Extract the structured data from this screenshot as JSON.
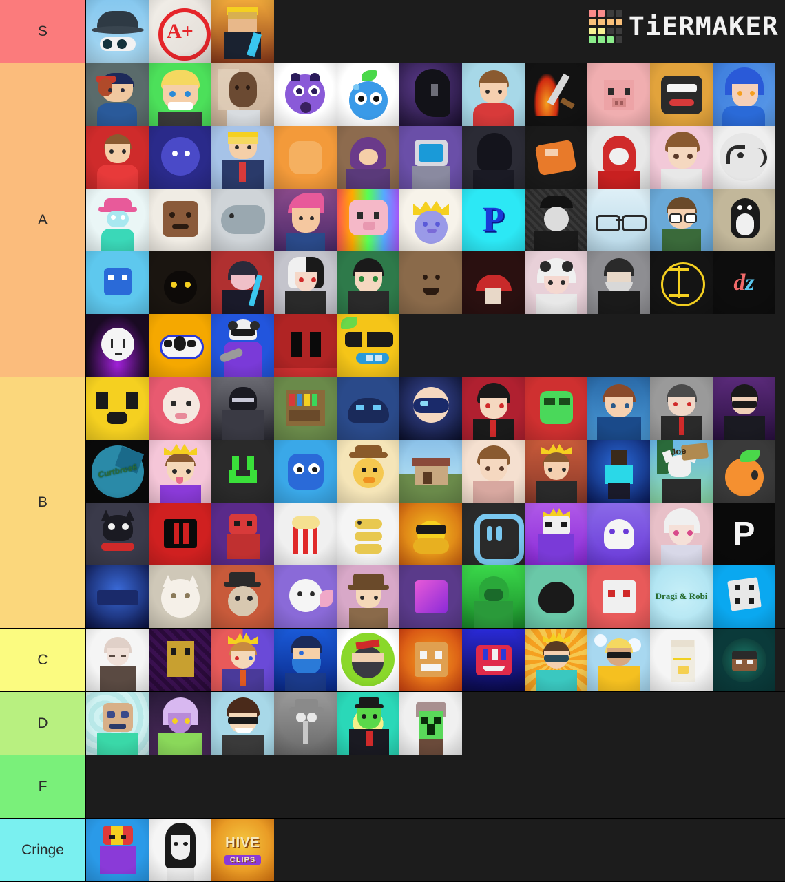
{
  "app": {
    "name": "TierMaker",
    "logo_word": "TiERMAKER",
    "logo_colors": [
      [
        "#f98b8b",
        "#f98b8b",
        "#3d3d3d",
        "#3d3d3d"
      ],
      [
        "#f9c07a",
        "#f9c07a",
        "#f9c07a",
        "#f9c07a"
      ],
      [
        "#f7f293",
        "#f7f293",
        "#3d3d3d",
        "#3d3d3d"
      ],
      [
        "#8ced8c",
        "#8ced8c",
        "#8ced8c",
        "#3d3d3d"
      ]
    ],
    "background": "#1c1c1c"
  },
  "tiers": [
    {
      "label": "S",
      "color": "#fb7b7c",
      "rows": 1,
      "items": [
        {
          "name": "bucket-hat-sunglasses",
          "caption": "",
          "bg": "#7ec3ee",
          "kind": "hat-shades"
        },
        {
          "name": "a-plus-grade",
          "caption": "A+",
          "bg": "#ede8e4",
          "kind": "aplus"
        },
        {
          "name": "minecraft-king-sword",
          "caption": "",
          "bg": "#c96a2a",
          "kind": "mc-king-sunset"
        }
      ]
    },
    {
      "label": "A",
      "color": "#fbbc7c",
      "rows": 5,
      "items": [
        {
          "name": "boy-red-cap-hoodie",
          "caption": "",
          "bg": "#5a6b6b",
          "kind": "cap-boy"
        },
        {
          "name": "blond-anime-grin",
          "caption": "",
          "bg": "#4ce05a",
          "kind": "blond-grin"
        },
        {
          "name": "photo-person-selfie",
          "caption": "",
          "bg": "#d8c6b4",
          "kind": "photo-face"
        },
        {
          "name": "purple-shocked-ball",
          "caption": "",
          "bg": "#ffffff",
          "kind": "shock-ball"
        },
        {
          "name": "blueberry-character",
          "caption": "",
          "bg": "#ffffff",
          "kind": "blueberry"
        },
        {
          "name": "black-hair-galaxy",
          "caption": "",
          "bg": "#2a1d4a",
          "kind": "dark-hair"
        },
        {
          "name": "brown-hair-red-shirt",
          "caption": "",
          "bg": "#a7d8e8",
          "kind": "brown-red"
        },
        {
          "name": "flame-sword-pixel",
          "caption": "",
          "bg": "#111111",
          "kind": "flame-sword"
        },
        {
          "name": "minecraft-pig-face",
          "caption": "",
          "bg": "#f0aeb0",
          "kind": "mc-pig"
        },
        {
          "name": "geometry-dash-cube",
          "caption": "",
          "bg": "#e2a33c",
          "kind": "gd-cube"
        },
        {
          "name": "blue-hair-anime",
          "caption": "",
          "bg": "#3d7ddd",
          "kind": "blue-hair"
        },
        {
          "name": "red-hoodie-boy",
          "caption": "",
          "bg": "#cf2b2b",
          "kind": "red-hoodie"
        },
        {
          "name": "blue-blob-face",
          "caption": "",
          "bg": "#2a2a8a",
          "kind": "blue-blob"
        },
        {
          "name": "king-crown-suit",
          "caption": "",
          "bg": "#a6c3e8",
          "kind": "king-suit"
        },
        {
          "name": "orange-square-blob",
          "caption": "",
          "bg": "#f39a3a",
          "kind": "orange-blob"
        },
        {
          "name": "hooded-traveler",
          "caption": "",
          "bg": "#8d6b4e",
          "kind": "hooded"
        },
        {
          "name": "tv-head-robot",
          "caption": "",
          "bg": "#6a4fa8",
          "kind": "tv-head"
        },
        {
          "name": "dark-silhouette-hair",
          "caption": "",
          "bg": "#2b2b35",
          "kind": "dark-sil"
        },
        {
          "name": "pixel-fighter-orange",
          "caption": "",
          "bg": "#1a1a1a",
          "kind": "pixel-fight"
        },
        {
          "name": "red-hood-mask",
          "caption": "",
          "bg": "#e8e8e8",
          "kind": "red-hood"
        },
        {
          "name": "anime-brown-hair",
          "caption": "",
          "bg": "#f2c9d8",
          "kind": "anime-brown"
        },
        {
          "name": "white-doodle-face",
          "caption": "",
          "bg": "#efefef",
          "kind": "doodle-face"
        },
        {
          "name": "pink-hat-runner",
          "caption": "",
          "bg": "#eaf6f6",
          "kind": "pink-hat"
        },
        {
          "name": "brown-sack-head",
          "caption": "",
          "bg": "#f0ece4",
          "kind": "sack-head"
        },
        {
          "name": "manatee-gray",
          "caption": "",
          "bg": "#cfd4d8",
          "kind": "manatee"
        },
        {
          "name": "vegeta-pink-hair",
          "caption": "",
          "bg": "#8a4a8a",
          "kind": "vegeta"
        },
        {
          "name": "piggy-roblox-rainbow",
          "caption": "",
          "bg": "#5b3fa8",
          "kind": "piggy"
        },
        {
          "name": "crowned-purple-slime",
          "caption": "",
          "bg": "#f7f3ea",
          "kind": "slime-king"
        },
        {
          "name": "letter-p-logo",
          "caption": "P",
          "bg": "#2ce8f5",
          "kind": "p-logo"
        },
        {
          "name": "blank-face-cap",
          "caption": "",
          "bg": "#2a2a2a",
          "kind": "blank-cap"
        },
        {
          "name": "glasses-only",
          "caption": "",
          "bg": "#c8dce8",
          "kind": "glasses"
        },
        {
          "name": "boy-backpack-glasses",
          "caption": "",
          "bg": "#6aa9d8",
          "kind": "backpack-boy"
        },
        {
          "name": "penguin-sketch",
          "caption": "",
          "bg": "#c2b79a",
          "kind": "penguin"
        },
        {
          "name": "blue-slime-pixel",
          "caption": "",
          "bg": "#5ec8ee",
          "kind": "blue-slime"
        },
        {
          "name": "dark-cat-eyes",
          "caption": "",
          "bg": "#1a1510",
          "kind": "dark-cat"
        },
        {
          "name": "ninja-blue-sword",
          "caption": "",
          "bg": "#b03030",
          "kind": "ninja-sword"
        },
        {
          "name": "white-black-hair-anime",
          "caption": "",
          "bg": "#c4c4cc",
          "kind": "split-hair"
        },
        {
          "name": "panda-mask-anime",
          "caption": "",
          "bg": "#2e7a4a",
          "kind": "panda-mask"
        },
        {
          "name": "brown-smiley",
          "caption": "",
          "bg": "#8a6a4a",
          "kind": "brown-smile"
        },
        {
          "name": "red-mushroom-dark",
          "caption": "",
          "bg": "#2a1010",
          "kind": "red-mushroom"
        },
        {
          "name": "panda-hoodie-girl",
          "caption": "",
          "bg": "#e8d0d8",
          "kind": "panda-hoodie"
        },
        {
          "name": "masked-hoodie-gray",
          "caption": "",
          "bg": "#8e8e92",
          "kind": "masked-gray"
        },
        {
          "name": "neon-circle-emblem",
          "caption": "",
          "bg": "#141414",
          "kind": "neon-emblem"
        },
        {
          "name": "dz-logo",
          "caption": "dz",
          "bg": "#0d0d0d",
          "kind": "dz"
        },
        {
          "name": "white-face-purple-fire",
          "caption": "",
          "bg": "#190a22",
          "kind": "purple-fire"
        },
        {
          "name": "blue-outline-blob",
          "caption": "",
          "bg": "#f5a800",
          "kind": "blue-outline"
        },
        {
          "name": "panda-chainsaw",
          "caption": "",
          "bg": "#2255dd",
          "kind": "panda-saw"
        },
        {
          "name": "red-black-pixel-face",
          "caption": "",
          "bg": "#b02424",
          "kind": "red-pixel"
        },
        {
          "name": "lemon-sunglasses",
          "caption": "",
          "bg": "#f5c518",
          "kind": "lemon-shades"
        }
      ]
    },
    {
      "label": "B",
      "color": "#fbd77c",
      "rows": 4,
      "items": [
        {
          "name": "yellow-koala-face",
          "caption": "",
          "bg": "#f5d020",
          "kind": "koala"
        },
        {
          "name": "strawberry-piggy",
          "caption": "",
          "bg": "#e85a70",
          "kind": "strawberry"
        },
        {
          "name": "gray-armored-figure",
          "caption": "",
          "bg": "#4a4a52",
          "kind": "armored"
        },
        {
          "name": "bookshelf-pixel",
          "caption": "",
          "bg": "#6a8a4a",
          "kind": "bookshelf"
        },
        {
          "name": "dark-blue-creature",
          "caption": "",
          "bg": "#2a4a8a",
          "kind": "blue-creature"
        },
        {
          "name": "galaxy-visor-head",
          "caption": "",
          "bg": "#1a2a5a",
          "kind": "galaxy-visor"
        },
        {
          "name": "anime-black-hair-red",
          "caption": "",
          "bg": "#b02030",
          "kind": "anime-red"
        },
        {
          "name": "green-face-gg",
          "caption": "",
          "bg": "#cf3030",
          "kind": "gg-green"
        },
        {
          "name": "anime-boy-blue-jacket",
          "caption": "",
          "bg": "#2a6aa8",
          "kind": "blue-jacket"
        },
        {
          "name": "gray-suit-red-eyes",
          "caption": "",
          "bg": "#9a9a9a",
          "kind": "gray-suit"
        },
        {
          "name": "dark-suit-shades",
          "caption": "",
          "bg": "#5a2a7a",
          "kind": "suit-shades"
        },
        {
          "name": "curtbros6-logo",
          "caption": "Curtbros6",
          "bg": "#0a0a0a",
          "kind": "curt"
        },
        {
          "name": "crowned-boy-pink",
          "caption": "",
          "bg": "#f5c6d8",
          "kind": "crown-boy-pink"
        },
        {
          "name": "green-pixel-smile",
          "caption": "",
          "bg": "#2a2a2a",
          "kind": "green-smile"
        },
        {
          "name": "blue-slime-big-eyes",
          "caption": "",
          "bg": "#3aa8e8",
          "kind": "blue-eyes"
        },
        {
          "name": "duck-hat-cartoon",
          "caption": "",
          "bg": "#f5e5b8",
          "kind": "duck-hat"
        },
        {
          "name": "minecraft-village-pixel",
          "caption": "",
          "bg": "#8aa8c8",
          "kind": "village"
        },
        {
          "name": "brown-hair-anime-boy",
          "caption": "",
          "bg": "#f5e0d0",
          "kind": "brown-anime"
        },
        {
          "name": "crown-boy-dark-jacket",
          "caption": "",
          "bg": "#c85a3a",
          "kind": "crown-dark"
        },
        {
          "name": "lightning-minecraft-skin",
          "caption": "",
          "bg": "#1a3a8a",
          "kind": "lightning"
        },
        {
          "name": "fox-mask-joe-sign",
          "caption": "Joe",
          "bg": "#6ab8e8",
          "kind": "joe"
        },
        {
          "name": "orange-fruit-face",
          "caption": "",
          "bg": "#3a3a3a",
          "kind": "orange-fruit"
        },
        {
          "name": "black-cat-red-scarf",
          "caption": "",
          "bg": "#3a3a4a",
          "kind": "cat-scarf"
        },
        {
          "name": "red-black-logo",
          "caption": "",
          "bg": "#d02020",
          "kind": "red-logo"
        },
        {
          "name": "red-pixel-character",
          "caption": "",
          "bg": "#5a2a8a",
          "kind": "red-char"
        },
        {
          "name": "pixel-popcorn",
          "caption": "",
          "bg": "#f0f0f0",
          "kind": "popcorn"
        },
        {
          "name": "pixel-snake",
          "caption": "",
          "bg": "#f5f5f5",
          "kind": "snake"
        },
        {
          "name": "bee-sunglasses",
          "caption": "",
          "bg": "#f5a020",
          "kind": "bee"
        },
        {
          "name": "rounded-square-icon",
          "caption": "",
          "bg": "#2a2a2a",
          "kind": "rounded-icon"
        },
        {
          "name": "crown-purple-skin",
          "caption": "",
          "bg": "#9a4ad8",
          "kind": "purple-crown"
        },
        {
          "name": "white-ghost-purple",
          "caption": "",
          "bg": "#7a5ad8",
          "kind": "ghost-purple"
        },
        {
          "name": "anime-girl-white-hair",
          "caption": "",
          "bg": "#e8c0c8",
          "kind": "anime-white"
        },
        {
          "name": "letter-p-white",
          "caption": "P",
          "bg": "#0a0a0a",
          "kind": "p-white"
        },
        {
          "name": "rome-plays-banner",
          "caption": "",
          "bg": "#1a2a6a",
          "kind": "rome"
        },
        {
          "name": "white-cat-photo",
          "caption": "",
          "bg": "#cfc8b8",
          "kind": "white-cat"
        },
        {
          "name": "sloth-top-hat",
          "caption": "",
          "bg": "#c85a3a",
          "kind": "sloth"
        },
        {
          "name": "white-dragon-pink",
          "caption": "",
          "bg": "#8a6ad8",
          "kind": "white-dragon"
        },
        {
          "name": "brown-hat-character",
          "caption": "",
          "bg": "#d8a8c8",
          "kind": "brown-hat"
        },
        {
          "name": "pink-cube-pixel",
          "caption": "",
          "bg": "#5a3a8a",
          "kind": "pink-cube"
        },
        {
          "name": "green-hoodie-figure",
          "caption": "",
          "bg": "#3ad84a",
          "kind": "green-hood"
        },
        {
          "name": "black-hair-top",
          "caption": "",
          "bg": "#6ac8a8",
          "kind": "black-top"
        },
        {
          "name": "white-red-pixel-face",
          "caption": "",
          "bg": "#e85a5a",
          "kind": "white-red"
        },
        {
          "name": "dragi-robi-text",
          "caption": "Dragi & Robi",
          "bg": "#a8e8f0",
          "kind": "dragi"
        },
        {
          "name": "minecraft-dice-block",
          "caption": "",
          "bg": "#0aa8f0",
          "kind": "dice"
        }
      ]
    },
    {
      "label": "C",
      "color": "#fbfb80",
      "rows": 1,
      "items": [
        {
          "name": "old-man-sketch",
          "caption": "",
          "bg": "#f5f5f5",
          "kind": "old-man"
        },
        {
          "name": "pixel-golem-purple",
          "caption": "",
          "bg": "#2a0a3a",
          "kind": "golem"
        },
        {
          "name": "king-crown-suit-red",
          "caption": "",
          "bg": "#e85a5a",
          "kind": "king-red"
        },
        {
          "name": "masked-blue-hero",
          "caption": "",
          "bg": "#1a5ad8",
          "kind": "blue-hero"
        },
        {
          "name": "ninja-green-circle",
          "caption": "",
          "bg": "#8ad82a",
          "kind": "ninja-green"
        },
        {
          "name": "tiger-minecraft-head",
          "caption": "",
          "bg": "#f07020",
          "kind": "tiger"
        },
        {
          "name": "red-blue-face-icon",
          "caption": "",
          "bg": "#1a1a5a",
          "kind": "red-blue-face"
        },
        {
          "name": "crown-shades-anime",
          "caption": "",
          "bg": "#f09040",
          "kind": "crown-shades"
        },
        {
          "name": "blond-yellow-hoodie",
          "caption": "",
          "bg": "#a8d8f0",
          "kind": "yellow-hoodie"
        },
        {
          "name": "milk-carton",
          "caption": "",
          "bg": "#f5f5f5",
          "kind": "milk"
        },
        {
          "name": "minecraft-head-teal",
          "caption": "",
          "bg": "#0a3a3a",
          "kind": "teal-head"
        }
      ]
    },
    {
      "label": "D",
      "color": "#b8f080",
      "rows": 1,
      "items": [
        {
          "name": "burlap-mask-teal",
          "caption": "",
          "bg": "#b8e8e8",
          "kind": "burlap"
        },
        {
          "name": "purple-hair-anime-girl",
          "caption": "",
          "bg": "#2a1a3a",
          "kind": "purple-hair"
        },
        {
          "name": "brown-hair-sunglasses",
          "caption": "",
          "bg": "#a8d8e8",
          "kind": "brown-shades"
        },
        {
          "name": "squidward-grayscale",
          "caption": "",
          "bg": "#8a8a8a",
          "kind": "squid"
        },
        {
          "name": "green-alien-suit",
          "caption": "",
          "bg": "#2ad8b8",
          "kind": "alien"
        },
        {
          "name": "creeper-hair-skin",
          "caption": "",
          "bg": "#f0f0f0",
          "kind": "creeper"
        }
      ]
    },
    {
      "label": "F",
      "color": "#7af07a",
      "rows": 1,
      "items": []
    },
    {
      "label": "Cringe",
      "color": "#7 af0f0",
      "rows": 1,
      "items": [
        {
          "name": "red-yellow-character",
          "caption": "",
          "bg": "#2a9ae8",
          "kind": "red-yellow"
        },
        {
          "name": "anime-girl-manga-bw",
          "caption": "",
          "bg": "#f5f5f5",
          "kind": "manga-girl"
        },
        {
          "name": "hive-clips-logo",
          "caption": "HIVE",
          "caption2": "CLIPS",
          "bg": "#f0a020",
          "kind": "hive"
        }
      ]
    }
  ]
}
